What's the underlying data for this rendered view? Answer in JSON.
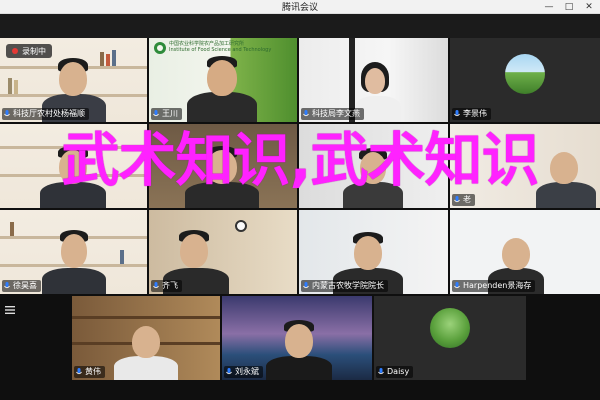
{
  "window": {
    "title": "腾讯会议",
    "controls": {
      "minimize": "—",
      "maximize": "□",
      "close": "✕"
    }
  },
  "recording": {
    "label": "录制中"
  },
  "watermark": "武术知识,武术知识",
  "org_banner": {
    "line1": "中国农业科学院农产品加工研究所",
    "line2": "Institute of Food Science and Technology"
  },
  "participants": [
    {
      "name": "科技厅农村处杨福顺",
      "mic": "on"
    },
    {
      "name": "王川",
      "mic": "on"
    },
    {
      "name": "科技局李文燕",
      "mic": "on"
    },
    {
      "name": "李景伟",
      "mic": "on"
    },
    {
      "name": "",
      "mic": "off"
    },
    {
      "name": "",
      "mic": "on"
    },
    {
      "name": "",
      "mic": "on"
    },
    {
      "name": "老",
      "mic": "on"
    },
    {
      "name": "徐昊喜",
      "mic": "on"
    },
    {
      "name": "齐飞",
      "mic": "on"
    },
    {
      "name": "内蒙古农牧学院院长",
      "mic": "on"
    },
    {
      "name": "Harpenden景海存",
      "mic": "on"
    },
    {
      "name": "黄伟",
      "mic": "on"
    },
    {
      "name": "刘永斌",
      "mic": "on"
    },
    {
      "name": "Daisy",
      "mic": "on"
    }
  ],
  "colors": {
    "accent_watermark": "#ff22ff",
    "mic_active": "#2e7dff",
    "record": "#e53935"
  }
}
